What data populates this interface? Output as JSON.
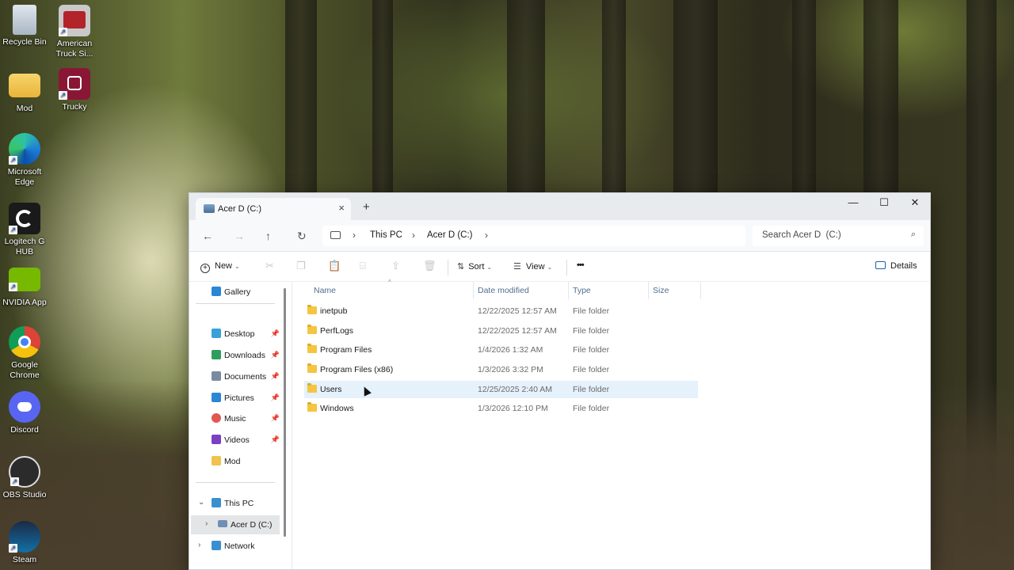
{
  "desktop": {
    "icons": [
      {
        "label": "Recycle Bin",
        "icon": "recycle-bin-icon"
      },
      {
        "label": "American Truck Si...",
        "icon": "ats-icon"
      },
      {
        "label": "Mod",
        "icon": "folder-icon"
      },
      {
        "label": "Trucky",
        "icon": "trucky-icon"
      },
      {
        "label": "Microsoft Edge",
        "icon": "edge-icon"
      },
      {
        "label": "Logitech G HUB",
        "icon": "ghub-icon"
      },
      {
        "label": "NVIDIA App",
        "icon": "nvidia-icon"
      },
      {
        "label": "Google Chrome",
        "icon": "chrome-icon"
      },
      {
        "label": "Discord",
        "icon": "discord-icon"
      },
      {
        "label": "OBS Studio",
        "icon": "obs-icon"
      },
      {
        "label": "Steam",
        "icon": "steam-icon"
      }
    ]
  },
  "window": {
    "tab_title": "Acer D  (C:)",
    "tab_close": "×",
    "new_tab": "+",
    "controls": {
      "minimize": "—",
      "maximize": "☐",
      "close": "✕"
    }
  },
  "navigation": {
    "back": "←",
    "forward": "→",
    "up": "↑",
    "refresh": "↻",
    "breadcrumbs": [
      "This PC",
      "Acer D  (C:)"
    ],
    "search_placeholder": "Search Acer D  (C:)",
    "search_icon": "⌕"
  },
  "toolbar": {
    "new_label": "New",
    "sort_label": "Sort",
    "view_label": "View",
    "more_label": "•••",
    "details_label": "Details"
  },
  "sidebar": {
    "gallery": "Gallery",
    "quick_access": [
      {
        "label": "Desktop",
        "color": "#3aa0d8"
      },
      {
        "label": "Downloads",
        "color": "#2f9e5c"
      },
      {
        "label": "Documents",
        "color": "#7a8ba0"
      },
      {
        "label": "Pictures",
        "color": "#2b86d4"
      },
      {
        "label": "Music",
        "color": "#e0584f"
      },
      {
        "label": "Videos",
        "color": "#7c3fc4"
      },
      {
        "label": "Mod",
        "color": "#f2c14e"
      }
    ],
    "this_pc": "This PC",
    "drive": "Acer D  (C:)",
    "network": "Network"
  },
  "files": {
    "columns": {
      "name": "Name",
      "date": "Date modified",
      "type": "Type",
      "size": "Size"
    },
    "rows": [
      {
        "name": "inetpub",
        "date": "12/22/2025 12:57 AM",
        "type": "File folder"
      },
      {
        "name": "PerfLogs",
        "date": "12/22/2025 12:57 AM",
        "type": "File folder"
      },
      {
        "name": "Program Files",
        "date": "1/4/2026 1:32 AM",
        "type": "File folder"
      },
      {
        "name": "Program Files (x86)",
        "date": "1/3/2026 3:32 PM",
        "type": "File folder"
      },
      {
        "name": "Users",
        "date": "12/25/2025 2:40 AM",
        "type": "File folder"
      },
      {
        "name": "Windows",
        "date": "1/3/2026 12:10 PM",
        "type": "File folder"
      }
    ]
  }
}
